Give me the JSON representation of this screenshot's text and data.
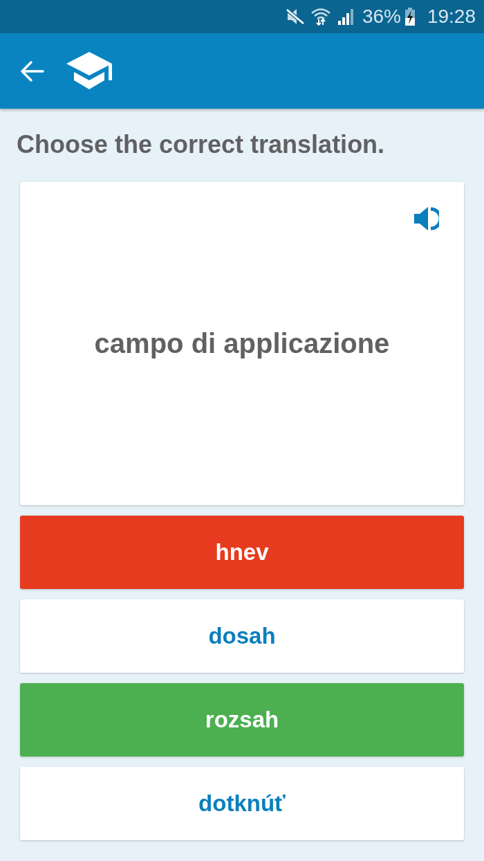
{
  "status_bar": {
    "battery": "36%",
    "time": "19:28"
  },
  "prompt": "Choose the correct translation.",
  "card": {
    "word": "campo di applicazione"
  },
  "answers": [
    {
      "label": "hnev",
      "kind": "wrong"
    },
    {
      "label": "dosah",
      "kind": "plain"
    },
    {
      "label": "rozsah",
      "kind": "correct"
    },
    {
      "label": "dotknúť",
      "kind": "plain"
    }
  ]
}
